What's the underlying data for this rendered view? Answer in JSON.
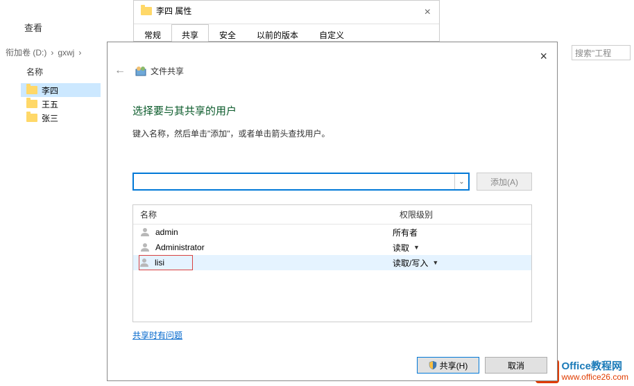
{
  "explorer": {
    "toolbar_view": "查看",
    "breadcrumb": {
      "part1": "衔加卷 (D:)",
      "sep": "›",
      "part2": "gxwj",
      "part3": "..."
    },
    "search_placeholder": "搜索\"工程",
    "name_header": "名称",
    "folders": [
      {
        "label": "李四",
        "selected": true
      },
      {
        "label": "王五",
        "selected": false
      },
      {
        "label": "张三",
        "selected": false
      }
    ]
  },
  "props": {
    "title": "李四 属性",
    "tabs": {
      "general": "常规",
      "share": "共享",
      "security": "安全",
      "prev": "以前的版本",
      "custom": "自定义"
    }
  },
  "share": {
    "title": "文件共享",
    "heading": "选择要与其共享的用户",
    "instruction": "键入名称，然后单击\"添加\"，或者单击箭头查找用户。",
    "add_button": "添加(A)",
    "columns": {
      "name": "名称",
      "perm": "权限级别"
    },
    "users": [
      {
        "name": "admin",
        "perm": "所有者",
        "arrow": false,
        "highlight": false
      },
      {
        "name": "Administrator",
        "perm": "读取",
        "arrow": true,
        "highlight": false
      },
      {
        "name": "lisi",
        "perm": "读取/写入",
        "arrow": true,
        "highlight": true
      }
    ],
    "help_link": "共享时有问题",
    "share_btn": "共享(H)",
    "cancel_btn": "取消"
  },
  "watermark": {
    "title": "Office教程网",
    "url": "www.office26.com"
  }
}
